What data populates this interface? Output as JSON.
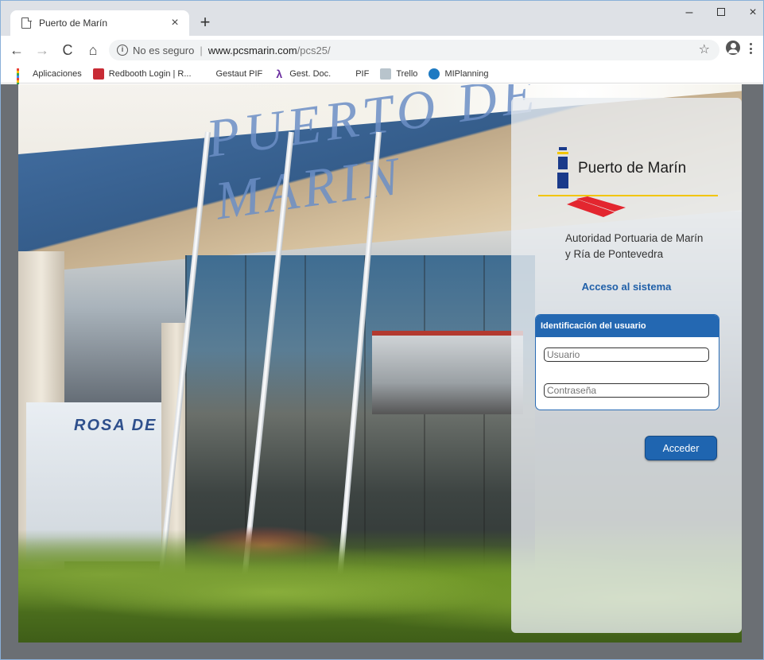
{
  "browser": {
    "tab_title": "Puerto de Marín",
    "tab_close": "×",
    "new_tab": "+",
    "window_controls": {
      "minimize": "–",
      "close": "×"
    },
    "nav": {
      "back": "←",
      "forward": "→",
      "reload": "C",
      "home": "⌂"
    },
    "address": {
      "security": "No es seguro",
      "separator": "|",
      "host": "www.pcsmarin.com",
      "path": "/pcs25/"
    },
    "star": "☆"
  },
  "bookmarks": [
    {
      "label": "Aplicaciones",
      "icon": "apps-grid-icon"
    },
    {
      "label": "Redbooth Login | R...",
      "icon": "redbooth-icon"
    },
    {
      "label": "Gestaut PIF",
      "icon": "page-icon"
    },
    {
      "label": "Gest. Doc.",
      "icon": "lambda-icon"
    },
    {
      "label": "PIF",
      "icon": "page-icon"
    },
    {
      "label": "Trello",
      "icon": "trello-icon"
    },
    {
      "label": "MIPlanning",
      "icon": "miplanning-icon"
    }
  ],
  "hero": {
    "sign_text": "PUERTO DE MARIN",
    "building_sign": "ROSA DE L"
  },
  "login": {
    "brand_name": "Puerto de Marín",
    "authority_line1": "Autoridad Portuaria de Marín",
    "authority_line2": "y Ría de Pontevedra",
    "access_title": "Acceso al sistema",
    "id_header": "Identificación del usuario",
    "user_placeholder": "Usuario",
    "password_placeholder": "Contraseña",
    "submit_label": "Acceder"
  },
  "colors": {
    "brand_blue": "#1a3a8a",
    "brand_yellow": "#f2c500",
    "brand_red": "#e3262f",
    "accent_blue": "#2468b2",
    "access_text": "#1f5fa8"
  }
}
